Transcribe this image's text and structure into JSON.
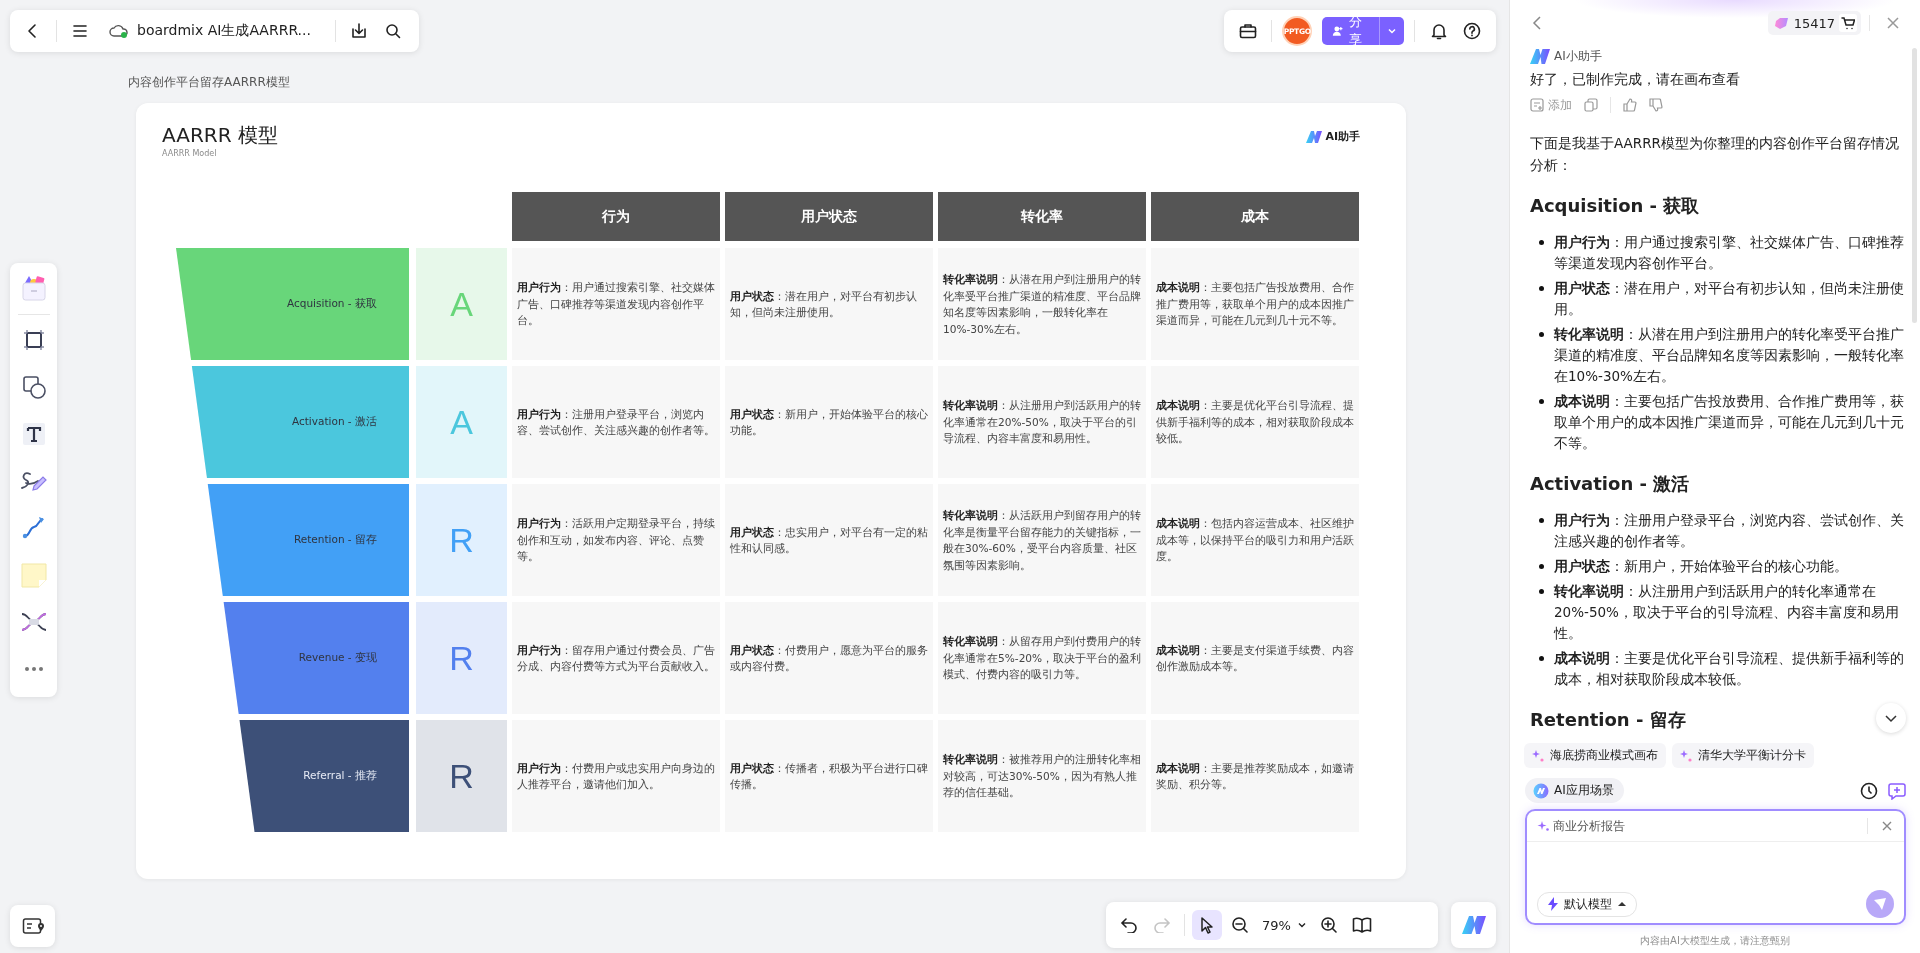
{
  "top_bar": {
    "title": "boardmix AI生成AARRR..."
  },
  "header_right": {
    "avatar_text": "PPTGO",
    "share": "分享"
  },
  "breadcrumb": "内容创作平台留存AARRR模型",
  "board": {
    "title": "AARRR 模型",
    "subtitle": "AARRR Model",
    "badge": "AI助手",
    "columns": [
      "行为",
      "用户状态",
      "转化率",
      "成本"
    ],
    "stages": [
      {
        "name": "Acquisition - 获取",
        "letter": "A",
        "color": "#68d67a",
        "cells": [
          "**用户行为**：用户通过搜索引擎、社交媒体广告、口碑推荐等渠道发现内容创作平台。",
          "**用户状态**：潜在用户，对平台有初步认知，但尚未注册使用。",
          "**转化率说明**：从潜在用户到注册用户的转化率受平台推广渠道的精准度、平台品牌知名度等因素影响，一般转化率在10%-30%左右。",
          "**成本说明**：主要包括广告投放费用、合作推广费用等，获取单个用户的成本因推广渠道而异，可能在几元到几十元不等。"
        ]
      },
      {
        "name": "Activation - 激活",
        "letter": "A",
        "color": "#4bc7dd",
        "cells": [
          "**用户行为**：注册用户登录平台，浏览内容、尝试创作、关注感兴趣的创作者等。",
          "**用户状态**：新用户，开始体验平台的核心功能。",
          "**转化率说明**：从注册用户到活跃用户的转化率通常在20%-50%，取决于平台的引导流程、内容丰富度和易用性。",
          "**成本说明**：主要是优化平台引导流程、提供新手福利等的成本，相对获取阶段成本较低。"
        ]
      },
      {
        "name": "Retention - 留存",
        "letter": "R",
        "color": "#42a0f6",
        "cells": [
          "**用户行为**：活跃用户定期登录平台，持续创作和互动，如发布内容、评论、点赞等。",
          "**用户状态**：忠实用户，对平台有一定的粘性和认同感。",
          "**转化率说明**：从活跃用户到留存用户的转化率是衡量平台留存能力的关键指标，一般在30%-60%，受平台内容质量、社区氛围等因素影响。",
          "**成本说明**：包括内容运营成本、社区维护成本等，以保持平台的吸引力和用户活跃度。"
        ]
      },
      {
        "name": "Revenue - 变现",
        "letter": "R",
        "color": "#5380ee",
        "cells": [
          "**用户行为**：留存用户通过付费会员、广告分成、内容付费等方式为平台贡献收入。",
          "**用户状态**：付费用户，愿意为平台的服务或内容付费。",
          "**转化率说明**：从留存用户到付费用户的转化率通常在5%-20%，取决于平台的盈利模式、付费内容的吸引力等。",
          "**成本说明**：主要是支付渠道手续费、内容创作激励成本等。"
        ]
      },
      {
        "name": "Referral - 推荐",
        "letter": "R",
        "color": "#3d5078",
        "cells": [
          "**用户行为**：付费用户或忠实用户向身边的人推荐平台，邀请他们加入。",
          "**用户状态**：传播者，积极为平台进行口碑传播。",
          "**转化率说明**：被推荐用户的注册转化率相对较高，可达30%-50%，因为有熟人推荐的信任基础。",
          "**成本说明**：主要是推荐奖励成本，如邀请奖励、积分等。"
        ]
      }
    ]
  },
  "bottom_toolbar": {
    "undo_disabled": false,
    "redo_disabled": true,
    "pointer_selected": true,
    "zoom": "79%"
  },
  "assistant": {
    "credits": "15417",
    "name": "AI小助手",
    "reply": "好了，已制作完成，请在画布查看",
    "add": "添加",
    "intro": "下面是我基于AARRR模型为你整理的内容创作平台留存情况分析：",
    "sections": [
      {
        "heading": "Acquisition - 获取",
        "bullets": [
          "**用户行为**：用户通过搜索引擎、社交媒体广告、口碑推荐等渠道发现内容创作平台。",
          "**用户状态**：潜在用户，对平台有初步认知，但尚未注册使用。",
          "**转化率说明**：从潜在用户到注册用户的转化率受平台推广渠道的精准度、平台品牌知名度等因素影响，一般转化率在10%-30%左右。",
          "**成本说明**：主要包括广告投放费用、合作推广费用等，获取单个用户的成本因推广渠道而异，可能在几元到几十元不等。"
        ]
      },
      {
        "heading": "Activation - 激活",
        "bullets": [
          "**用户行为**：注册用户登录平台，浏览内容、尝试创作、关注感兴趣的创作者等。",
          "**用户状态**：新用户，开始体验平台的核心功能。",
          "**转化率说明**：从注册用户到活跃用户的转化率通常在20%-50%，取决于平台的引导流程、内容丰富度和易用性。",
          "**成本说明**：主要是优化平台引导流程、提供新手福利等的成本，相对获取阶段成本较低。"
        ]
      },
      {
        "heading": "Retention - 留存"
      }
    ],
    "chips": [
      "海底捞商业模式画布",
      "清华大学平衡计分卡"
    ],
    "scene_button": "AI应用场景",
    "input_tag": "商业分析报告",
    "model": "默认模型",
    "footer": "内容由AI大模型生成，请注意甄别"
  }
}
